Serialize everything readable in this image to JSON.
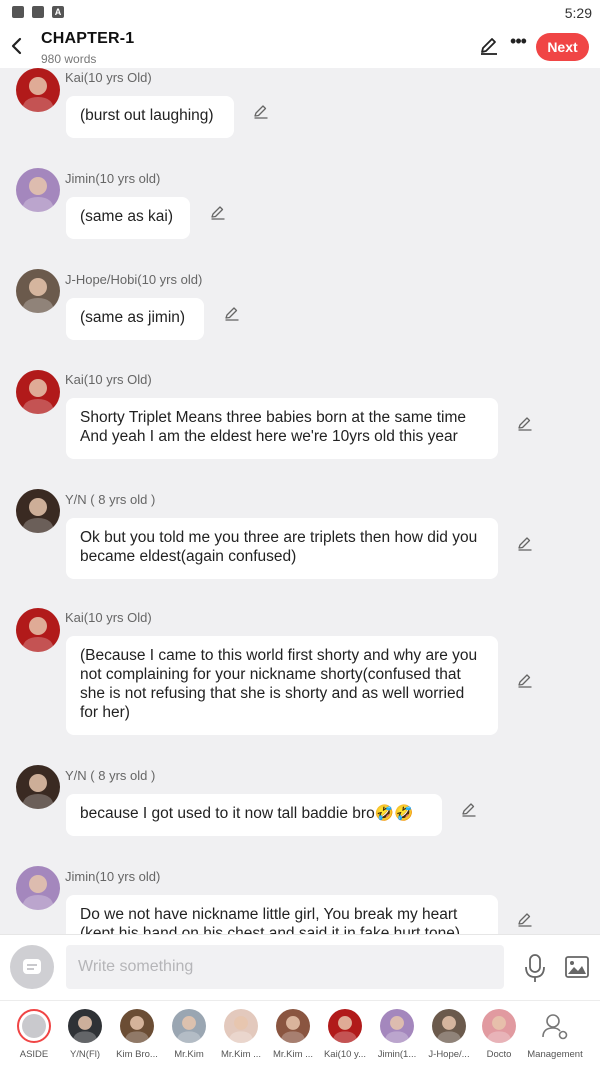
{
  "status_bar": {
    "time": "5:29",
    "icons": [
      "image-icon",
      "folder-icon",
      "a-icon"
    ]
  },
  "header": {
    "title": "CHAPTER-1",
    "word_count": "980 words",
    "next_label": "Next",
    "icons": [
      "back-icon",
      "pen-icon",
      "more-icon"
    ]
  },
  "messages": [
    {
      "sender": "Kai(10 yrs Old)",
      "text": "(burst out laughing)",
      "avatar_color": "#b11a1a"
    },
    {
      "sender": "Jimin(10 yrs old)",
      "text": "(same as kai)",
      "avatar_color": "#a487bd"
    },
    {
      "sender": "J-Hope/Hobi(10 yrs old)",
      "text": "(same as jimin)",
      "avatar_color": "#6b5a4c"
    },
    {
      "sender": "Kai(10 yrs Old)",
      "text": "Shorty Triplet Means three babies born at the same time And yeah I am the eldest here we're 10yrs old this year",
      "avatar_color": "#b11a1a"
    },
    {
      "sender": "Y/N ( 8 yrs old )",
      "text": "Ok but you told me you three are triplets then how did you became eldest(again confused)",
      "avatar_color": "#3a2a22"
    },
    {
      "sender": "Kai(10 yrs Old)",
      "text": "(Because I came to this world first shorty and why are you not complaining for your nickname shorty(confused that she is not refusing that she is shorty and as well worried for her)",
      "avatar_color": "#b11a1a"
    },
    {
      "sender": "Y/N ( 8 yrs old )",
      "text": "because I got used to it now tall baddie bro🤣🤣",
      "avatar_color": "#3a2a22"
    },
    {
      "sender": "Jimin(10 yrs old)",
      "text": "Do we not have nickname little girl, You break my heart (kept his hand on his chest and said it in fake hurt tone)",
      "avatar_color": "#a487bd"
    }
  ],
  "composer": {
    "placeholder": "Write something",
    "icons": [
      "aside-icon",
      "mic-icon",
      "image-icon"
    ]
  },
  "characters": [
    {
      "label": "ASIDE",
      "color": "#c9c9cd"
    },
    {
      "label": "Y/N(Fl)",
      "color": "#2f3236"
    },
    {
      "label": "Kim Bro...",
      "color": "#6b4d34"
    },
    {
      "label": "Mr.Kim",
      "color": "#9aa6b2"
    },
    {
      "label": "Mr.Kim ...",
      "color": "#e3c9bd"
    },
    {
      "label": "Mr.Kim ...",
      "color": "#8a5540"
    },
    {
      "label": "Kai(10 y...",
      "color": "#b11a1a"
    },
    {
      "label": "Jimin(1...",
      "color": "#a487bd"
    },
    {
      "label": "J-Hope/...",
      "color": "#6b5a4c"
    },
    {
      "label": "Docto",
      "color": "#e19aa0"
    },
    {
      "label": "Management",
      "color": "#ffffff"
    }
  ],
  "colors": {
    "accent": "#f04545",
    "background": "#f0f0f2",
    "bubble": "#ffffff"
  }
}
